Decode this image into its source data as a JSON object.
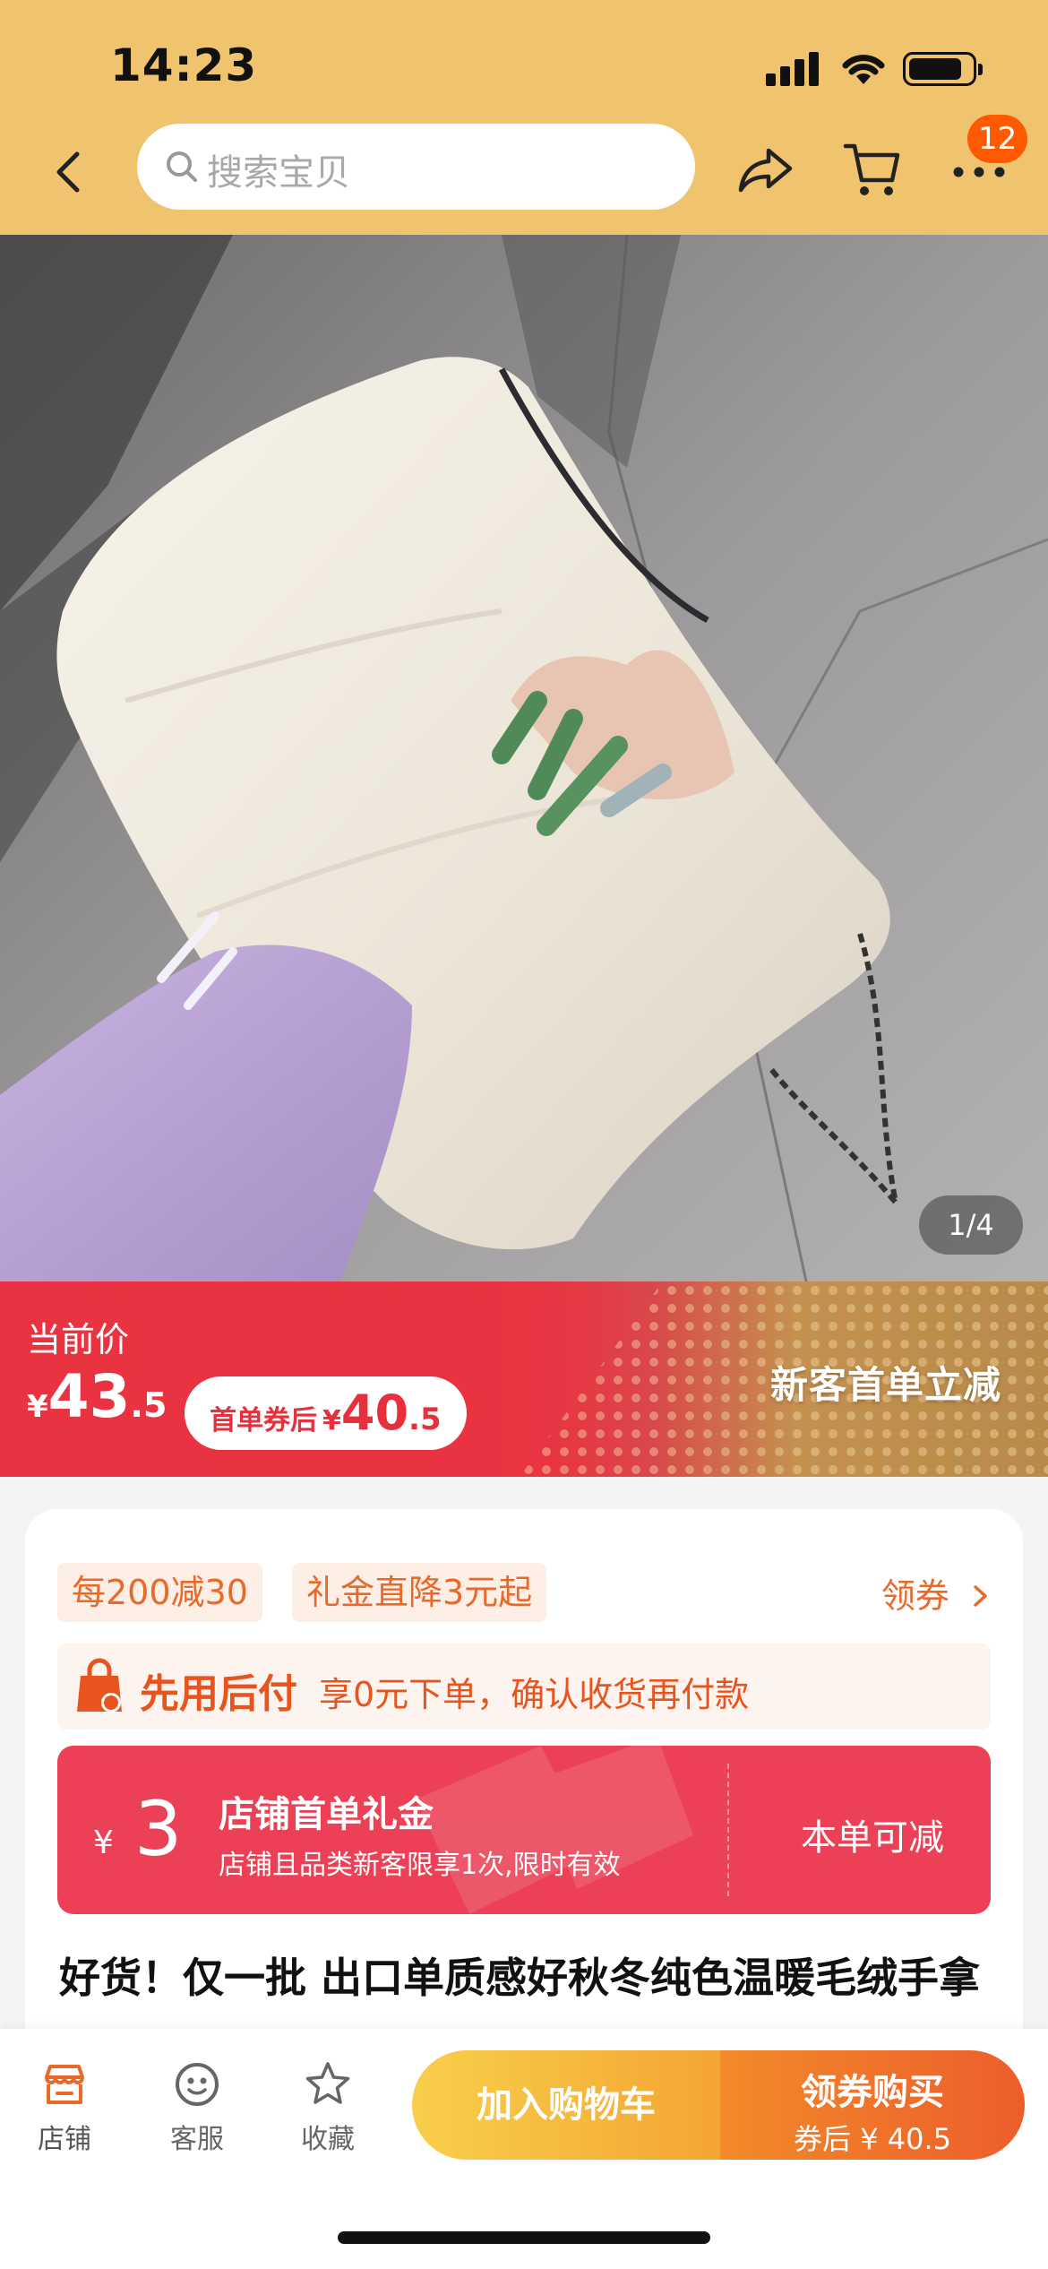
{
  "status_bar": {
    "time": "14:23"
  },
  "header": {
    "search_placeholder": "搜索宝贝",
    "badge_count": "12",
    "icons": [
      "back-arrow-icon",
      "search-icon",
      "share-icon",
      "cart-icon",
      "more-icon"
    ]
  },
  "product_image": {
    "counter": "1/4"
  },
  "price": {
    "label": "当前价",
    "currency": "¥",
    "integer": "43",
    "decimal": ".5",
    "coupon_label": "首单券后",
    "coupon_currency": "¥",
    "coupon_integer": "40",
    "coupon_decimal": ".5",
    "promo": "新客首单立减"
  },
  "offers": {
    "tags": [
      "每200减30",
      "礼金直降3元起"
    ],
    "coupon_link": "领券",
    "bnpl_title": "先用后付",
    "bnpl_desc": "享0元下单，确认收货再付款",
    "shop_coupon": {
      "currency": "¥",
      "amount": "3",
      "title": "店铺首单礼金",
      "desc": "店铺且品类新客限享1次,限时有效",
      "action": "本单可减"
    }
  },
  "product": {
    "title": "好货！仅一批 出口单质感好秋冬纯色温暖毛绒手拿斜挎包单肩包"
  },
  "bottom_bar": {
    "store": "店铺",
    "service": "客服",
    "favorite": "收藏",
    "add_to_cart": "加入购物车",
    "buy_title": "领券购买",
    "buy_sub": "券后 ¥ 40.5"
  },
  "colors": {
    "header_bg": "#f0c46e",
    "price_red": "#ea3340",
    "accent_orange": "#e86a2a",
    "coupon_red": "#eb4055"
  }
}
